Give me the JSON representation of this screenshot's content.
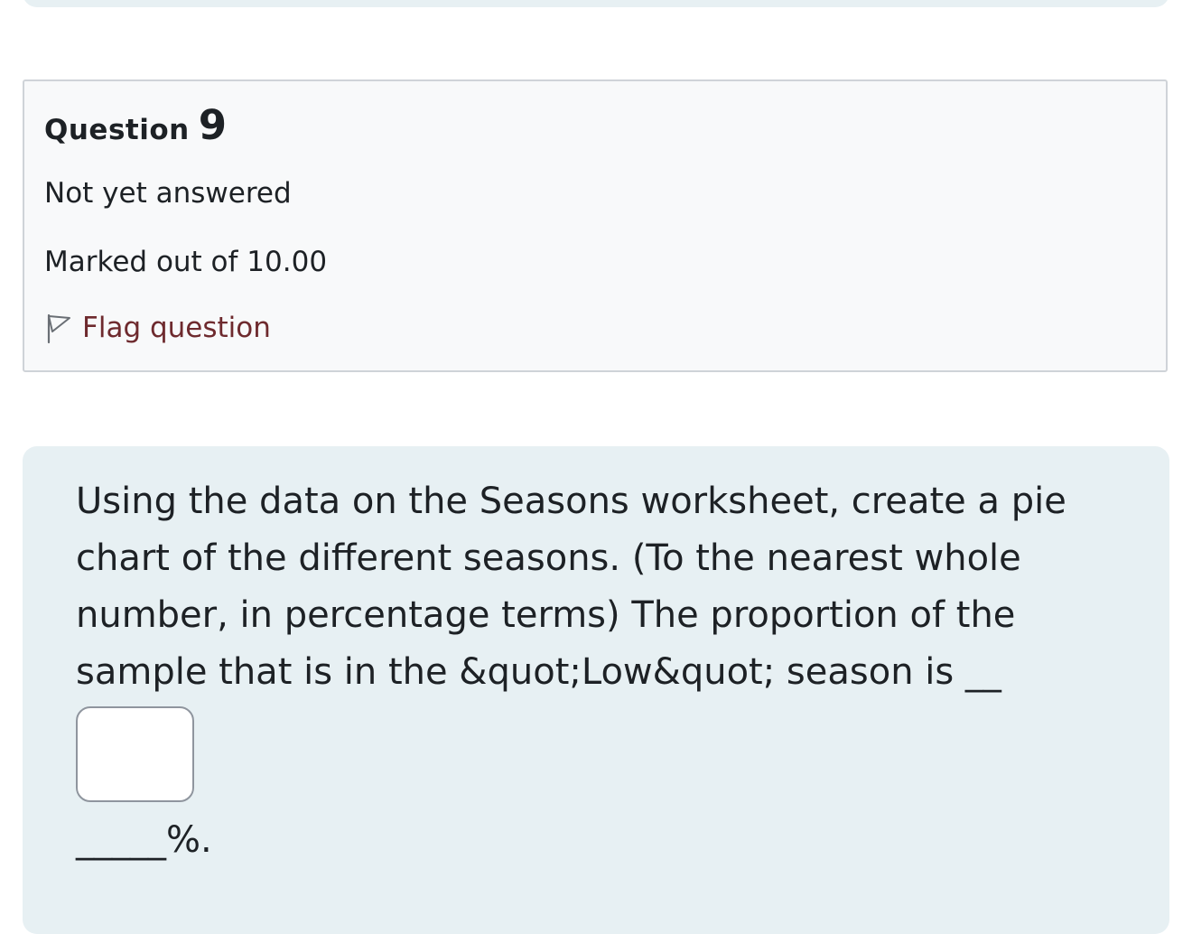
{
  "question": {
    "label": "Question",
    "number": "9",
    "state": "Not yet answered",
    "grade": "Marked out of 10.00",
    "flag_label": "Flag question"
  },
  "question_text": {
    "body": "Using the data on the Seasons worksheet, create a pie chart of the different seasons. (To the nearest whole number, in percentage terms) The proportion of the sample that is in the &quot;Low&quot; season is __",
    "answer_value": "",
    "suffix": "_____%."
  },
  "icons": {
    "flag": "flag-outline-icon"
  },
  "colors": {
    "info_bg": "#f8f9fa",
    "info_border": "#cfd3d8",
    "content_bg": "#e7f0f3",
    "link": "#6e2a2e"
  }
}
